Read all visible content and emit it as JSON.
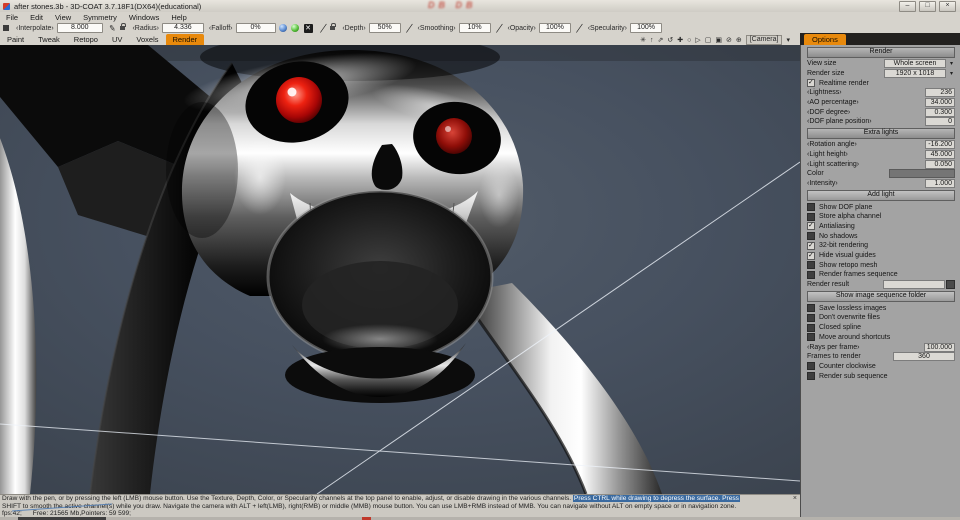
{
  "colors": {
    "accent": "#e8890c",
    "highlight": "#3a6aa0",
    "panel": "#a3a3a3"
  },
  "window": {
    "title": "after stones.3b - 3D-COAT 3.7.18F1(DX64)(educational)",
    "watermark": "DB DB",
    "minimize": "–",
    "maximize": "□",
    "close": "×"
  },
  "menu": {
    "items": [
      "File",
      "Edit",
      "View",
      "Symmetry",
      "Windows",
      "Help"
    ]
  },
  "toolbar": {
    "interpolate_label": "‹Interpolate›",
    "interpolate_value": "8.000",
    "radius_label": "‹Radius›",
    "radius_value": "4.336",
    "falloff_label": "‹Falloff›",
    "falloff_value": "0%",
    "depth_label": "‹Depth›",
    "depth_value": "50%",
    "smoothing_label": "‹Smoothing›",
    "smoothing_value": "10%",
    "opacity_label": "‹Opacity›",
    "opacity_value": "100%",
    "specularity_label": "‹Specularity›",
    "specularity_value": "100%",
    "x_icon": "✕"
  },
  "tabs": {
    "items": [
      "Paint",
      "Tweak",
      "Retopo",
      "UV",
      "Voxels",
      "Render"
    ],
    "active": "Render"
  },
  "vtoolbar": {
    "icons": [
      "✳",
      "↑",
      "⇗",
      "↺",
      "✚",
      "○",
      "▷",
      "▢",
      "▣",
      "⊘",
      "⊕"
    ],
    "camera": "[Camera]",
    "dropdown": "▾"
  },
  "panel": {
    "tab": "Options",
    "render_header": "Render",
    "view_size_label": "View size",
    "view_size_value": "Whole screen",
    "render_size_label": "Render size",
    "render_size_value": "1920 x 1018",
    "realtime": {
      "label": "Realtime render",
      "checked": true
    },
    "lightness_label": "‹Lightness›",
    "lightness_value": "236",
    "ao_label": "‹AO percentage›",
    "ao_value": "34.000",
    "dof_degree_label": "‹DOF degree›",
    "dof_degree_value": "0.300",
    "dof_plane_label": "‹DOF plane position›",
    "dof_plane_value": "0",
    "extra_lights_header": "Extra lights",
    "rotation_label": "‹Rotation angle›",
    "rotation_value": "-16.200",
    "light_height_label": "‹Light height›",
    "light_height_value": "45.000",
    "light_scatter_label": "‹Light scattering›",
    "light_scatter_value": "0.050",
    "color_label": "Color",
    "intensity_label": "‹Intensity›",
    "intensity_value": "1.000",
    "add_light_button": "Add light",
    "checks": [
      {
        "label": "Show DOF plane",
        "checked": false
      },
      {
        "label": "Store alpha channel",
        "checked": false
      },
      {
        "label": "Antialiasing",
        "checked": true
      },
      {
        "label": "No shadows",
        "checked": false
      },
      {
        "label": "32-bit rendering",
        "checked": true
      },
      {
        "label": "Hide visual guides",
        "checked": true
      },
      {
        "label": "Show retopo mesh",
        "checked": false
      },
      {
        "label": "Render frames sequence",
        "checked": false
      },
      {
        "label": "Save lossless images",
        "checked": false
      },
      {
        "label": "Don't overwrite files",
        "checked": false
      },
      {
        "label": "Closed spline",
        "checked": false
      },
      {
        "label": "Move around shortcuts",
        "checked": false
      },
      {
        "label": "Counter clockwise",
        "checked": false
      },
      {
        "label": "Render sub sequence",
        "checked": false
      }
    ],
    "render_result_label": "Render result",
    "render_result_value": "",
    "show_folder_button": "Show image sequence folder",
    "rays_label": "‹Rays per frame›",
    "rays_value": "100.000",
    "frames_label": "Frames to render",
    "frames_value": "360"
  },
  "status": {
    "line1": "Draw with the pen, or by pressing the left (LMB) mouse button. Use the Texture, Depth, Color, or Specularity channels at the top panel to enable, adjust, or disable drawing in the various channels. ",
    "line1_highlight": "Press CTRL while drawing to depress the surface. Press",
    "line2": "SHIFT to smooth the active channel(s) while you draw. Navigate the camera with ALT + left(LMB), right(RMB)  or middle (MMB) mouse button. You can use LMB+RMB instead of MMB. You can navigate without ALT on empty space or in navigation zone.",
    "close": "×",
    "stats": "fps:42;      Free: 21565 Mb,Pointers: 59 599;"
  }
}
